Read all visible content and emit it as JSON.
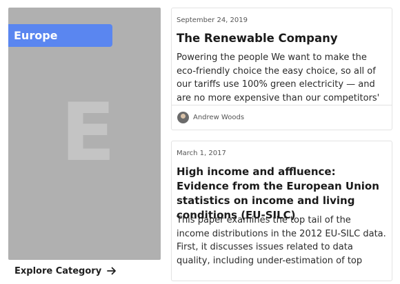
{
  "category": {
    "name": "Europe",
    "letter": "E",
    "explore_label": "Explore Category",
    "arrow_icon": "arrow-right-icon"
  },
  "articles": [
    {
      "date": "September 24, 2019",
      "title": "The Renewable Company",
      "excerpt": "Powering the people We want to make the eco-friendly choice the easy choice, so all of our tariffs use 100% green electricity — and are no more expensive than our competitors' non-green tariff…",
      "author": "Andrew Woods"
    },
    {
      "date": "March 1, 2017",
      "title": "High income and affluence: Evidence from the European Union statistics on income and living conditions (EU-SILC)",
      "excerpt": "This paper examines the top tail of the income distributions in the 2012 EU-SILC data. First, it discusses issues related to data quality, including under-estimation of top incomes. Then, the data…"
    }
  ],
  "colors": {
    "accent": "#5a86f0",
    "category_bg": "#b0b0b0"
  }
}
